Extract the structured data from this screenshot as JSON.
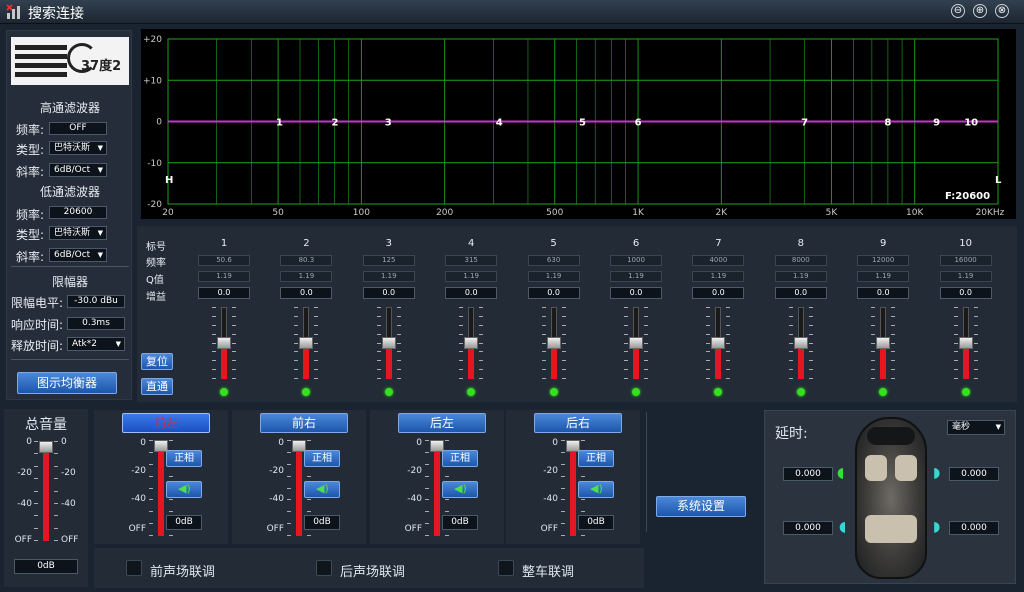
{
  "app": {
    "title": "搜索连接",
    "win_buttons": [
      "⊖",
      "⊕",
      "⊗"
    ]
  },
  "logo": {
    "text": "37度2"
  },
  "highpass": {
    "title": "高通滤波器",
    "freq_label": "频率:",
    "freq_value": "OFF",
    "type_label": "类型:",
    "type_value": "巴特沃斯",
    "slope_label": "斜率:",
    "slope_value": "6dB/Oct"
  },
  "lowpass": {
    "title": "低通滤波器",
    "freq_label": "频率:",
    "freq_value": "20600",
    "type_label": "类型:",
    "type_value": "巴特沃斯",
    "slope_label": "斜率:",
    "slope_value": "6dB/Oct"
  },
  "limiter": {
    "title": "限幅器",
    "level_label": "限幅电平:",
    "level_value": "-30.0 dBu",
    "response_label": "响应时间:",
    "response_value": "0.3ms",
    "release_label": "释放时间:",
    "release_value": "Atk*2"
  },
  "graphic_eq_button": "图示均衡器",
  "plot": {
    "y_ticks": [
      "+20",
      "+10",
      "0",
      "-10",
      "-20"
    ],
    "x_ticks": [
      "20",
      "50",
      "100",
      "200",
      "500",
      "1K",
      "2K",
      "5K",
      "10K",
      "20KHz"
    ],
    "band_markers": [
      "1",
      "2",
      "3",
      "4",
      "5",
      "6",
      "7",
      "8",
      "9",
      "10"
    ],
    "h_label": "H",
    "l_label": "L",
    "freq_readout": "F:20600",
    "colors": {
      "grid": "#1fa21f",
      "curve": "#c832c8",
      "background": "#000000"
    }
  },
  "eq": {
    "row_labels": {
      "band": "标号",
      "freq": "频率",
      "q": "Q值",
      "gain": "增益"
    },
    "bands": [
      {
        "num": "1",
        "freq": "50.6",
        "q": "1.19",
        "gain": "0.0"
      },
      {
        "num": "2",
        "freq": "80.3",
        "q": "1.19",
        "gain": "0.0"
      },
      {
        "num": "3",
        "freq": "125",
        "q": "1.19",
        "gain": "0.0"
      },
      {
        "num": "4",
        "freq": "315",
        "q": "1.19",
        "gain": "0.0"
      },
      {
        "num": "5",
        "freq": "630",
        "q": "1.19",
        "gain": "0.0"
      },
      {
        "num": "6",
        "freq": "1000",
        "q": "1.19",
        "gain": "0.0"
      },
      {
        "num": "7",
        "freq": "4000",
        "q": "1.19",
        "gain": "0.0"
      },
      {
        "num": "8",
        "freq": "8000",
        "q": "1.19",
        "gain": "0.0"
      },
      {
        "num": "9",
        "freq": "12000",
        "q": "1.19",
        "gain": "0.0"
      },
      {
        "num": "10",
        "freq": "16000",
        "q": "1.19",
        "gain": "0.0"
      }
    ],
    "slider_level": 0.5,
    "reset_button": "复位",
    "bypass_button": "直通"
  },
  "master": {
    "title": "总音量",
    "scale": [
      "0",
      "-20",
      "-40",
      "OFF"
    ],
    "value": "0dB",
    "level": 1.0
  },
  "channels": [
    {
      "name": "前左",
      "phase": "正相",
      "value": "0dB",
      "active": true,
      "level": 1.0
    },
    {
      "name": "前右",
      "phase": "正相",
      "value": "0dB",
      "active": false,
      "level": 1.0
    },
    {
      "name": "后左",
      "phase": "正相",
      "value": "0dB",
      "active": false,
      "level": 1.0
    },
    {
      "name": "后右",
      "phase": "正相",
      "value": "0dB",
      "active": false,
      "level": 1.0
    }
  ],
  "channel_scale": [
    "0",
    "-20",
    "-40",
    "OFF"
  ],
  "system_settings_button": "系统设置",
  "links": {
    "front": "前声场联调",
    "rear": "后声场联调",
    "all": "整车联调"
  },
  "delay": {
    "title": "延时:",
    "unit": "毫秒",
    "fl": "0.000",
    "fr": "0.000",
    "rl": "0.000",
    "rr": "0.000"
  }
}
